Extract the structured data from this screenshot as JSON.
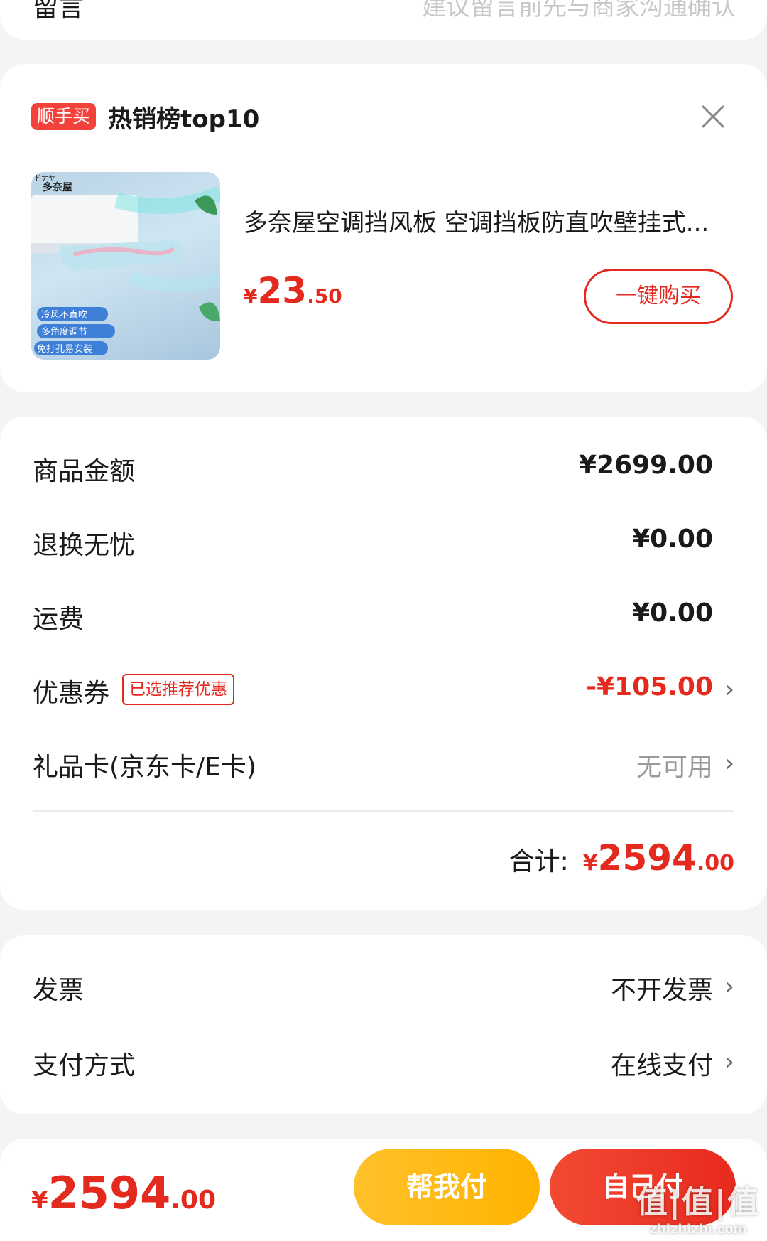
{
  "message": {
    "label": "留言",
    "placeholder": "建议留言前先与商家沟通确认"
  },
  "recommend": {
    "tag": "顺手买",
    "title": "热销榜top10",
    "close_icon": "close-icon",
    "product": {
      "name": "多奈屋空调挡风板 空调挡板防直吹壁挂式...",
      "price_symbol": "¥",
      "price_int": "23",
      "price_dec": ".50",
      "buy_label": "一键购买",
      "image_texts": {
        "brand_small": "ドナヤ",
        "brand": "多奈屋",
        "feature1": "冷风不直吹",
        "feature2": "多角度调节",
        "feature3": "免打孔易安装"
      }
    }
  },
  "summary": {
    "rows": [
      {
        "label": "商品金额",
        "value": "¥2699.00"
      },
      {
        "label": "退换无忧",
        "value": "¥0.00"
      },
      {
        "label": "运费",
        "value": "¥0.00"
      },
      {
        "label": "优惠券",
        "badge": "已选推荐优惠",
        "value": "-¥105.00"
      },
      {
        "label": "礼品卡(京东卡/E卡)",
        "value": "无可用"
      }
    ],
    "total": {
      "label": "合计:",
      "symbol": "¥",
      "int": "2594",
      "dec": ".00"
    }
  },
  "payment_section": {
    "rows": [
      {
        "label": "发票",
        "value": "不开发票"
      },
      {
        "label": "支付方式",
        "value": "在线支付"
      }
    ]
  },
  "bottom_bar": {
    "symbol": "¥",
    "int": "2594",
    "dec": ".00",
    "help_pay_label": "帮我付",
    "self_pay_label": "自己付"
  },
  "watermark": {
    "big": "值|值|值",
    "small": "zhizhizhi.com"
  },
  "colors": {
    "accent_red": "#e4291f",
    "help_btn_yellow": "#ffb300",
    "background": "#f4f4f5"
  }
}
